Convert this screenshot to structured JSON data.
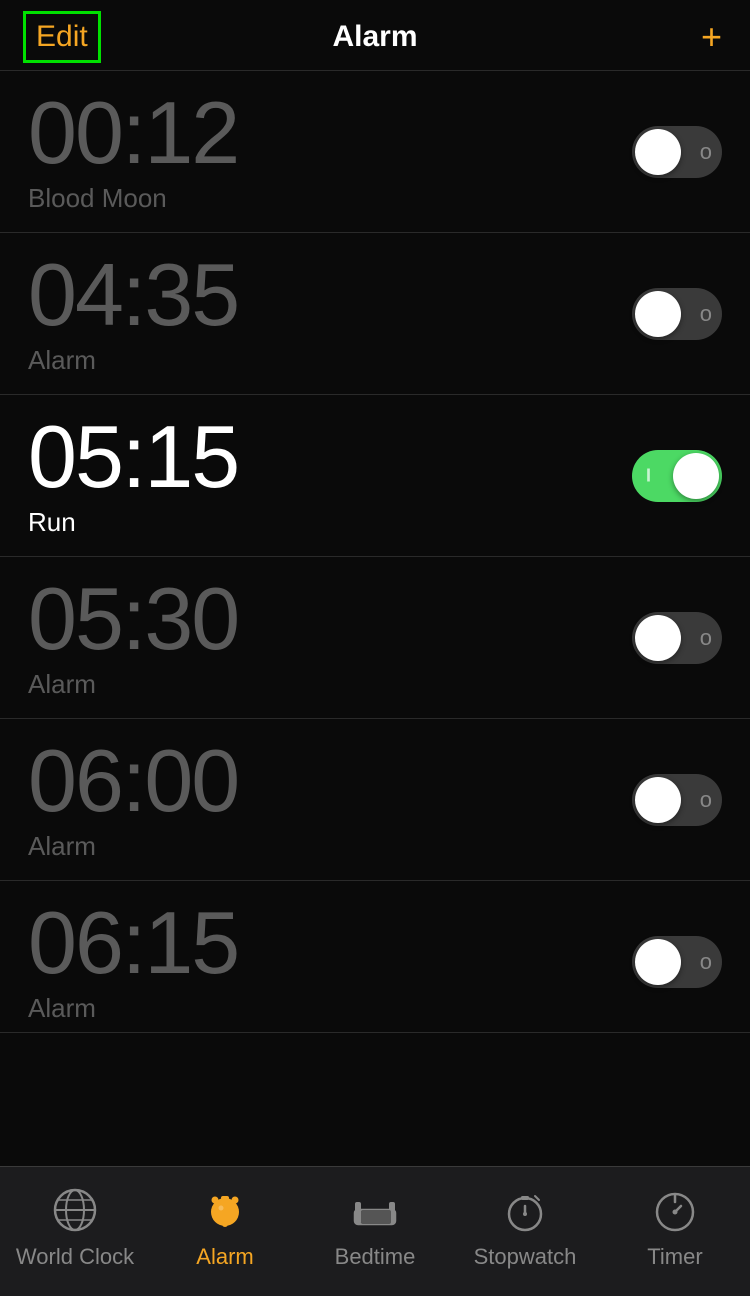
{
  "header": {
    "edit_label": "Edit",
    "title": "Alarm",
    "add_label": "+"
  },
  "alarms": [
    {
      "id": "alarm-1",
      "time": "00:12",
      "label": "Blood Moon",
      "active": false
    },
    {
      "id": "alarm-2",
      "time": "04:35",
      "label": "Alarm",
      "active": false
    },
    {
      "id": "alarm-3",
      "time": "05:15",
      "label": "Run",
      "active": true
    },
    {
      "id": "alarm-4",
      "time": "05:30",
      "label": "Alarm",
      "active": false
    },
    {
      "id": "alarm-5",
      "time": "06:00",
      "label": "Alarm",
      "active": false
    },
    {
      "id": "alarm-6",
      "time": "06:15",
      "label": "Alarm",
      "active": false
    }
  ],
  "tabs": [
    {
      "id": "world-clock",
      "label": "World Clock",
      "active": false
    },
    {
      "id": "alarm",
      "label": "Alarm",
      "active": true
    },
    {
      "id": "bedtime",
      "label": "Bedtime",
      "active": false
    },
    {
      "id": "stopwatch",
      "label": "Stopwatch",
      "active": false
    },
    {
      "id": "timer",
      "label": "Timer",
      "active": false
    }
  ],
  "colors": {
    "accent": "#f5a623",
    "toggle_on": "#4cd964",
    "toggle_off": "#3a3a3a",
    "active_text": "#ffffff",
    "inactive_text": "#5a5a5a"
  }
}
